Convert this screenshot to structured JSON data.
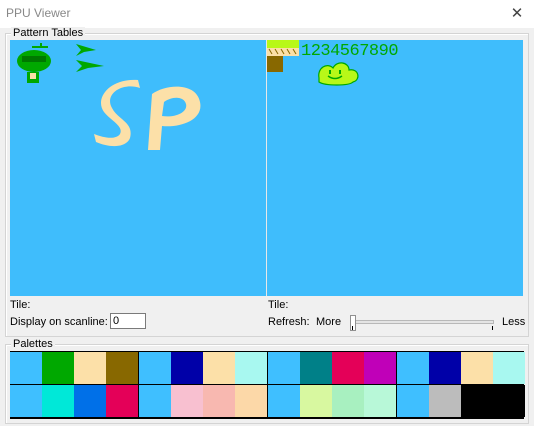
{
  "window": {
    "title": "PPU Viewer",
    "close_glyph": "✕"
  },
  "pattern_tables": {
    "group_label": "Pattern Tables",
    "left": {
      "tile_label": "Tile:",
      "scanline_label": "Display on scanline:",
      "scanline_value": "0"
    },
    "right": {
      "tile_label": "Tile:",
      "refresh_label": "Refresh:",
      "more_label": "More",
      "less_label": "Less"
    },
    "digits": "1234567890",
    "letters": "SP",
    "colors": {
      "background": "#3fbdfc",
      "green": "#00a800",
      "dark_green": "#007800",
      "tan": "#fce0a8",
      "brown": "#886800",
      "yellow_green": "#b8f818"
    }
  },
  "palettes": {
    "group_label": "Palettes",
    "rows": [
      [
        "#3fbfff",
        "#00a800",
        "#fce0a8",
        "#886800",
        "#3fbfff",
        "#0000a8",
        "#fce0a8",
        "#a8f8f0",
        "#3fbfff",
        "#008088",
        "#e40058",
        "#c000b8",
        "#3fbfff",
        "#0000a8",
        "#fce0a8",
        "#a8f8f0"
      ],
      [
        "#3fbfff",
        "#00e8d8",
        "#0070e8",
        "#e40058",
        "#3fbfff",
        "#f8c0d0",
        "#f8b8b0",
        "#fcd8a8",
        "#3fbfff",
        "#d8f8a0",
        "#a8f0c0",
        "#b8f8d8",
        "#3fbfff",
        "#bcbcbc",
        "#000000",
        "#000000"
      ]
    ]
  }
}
